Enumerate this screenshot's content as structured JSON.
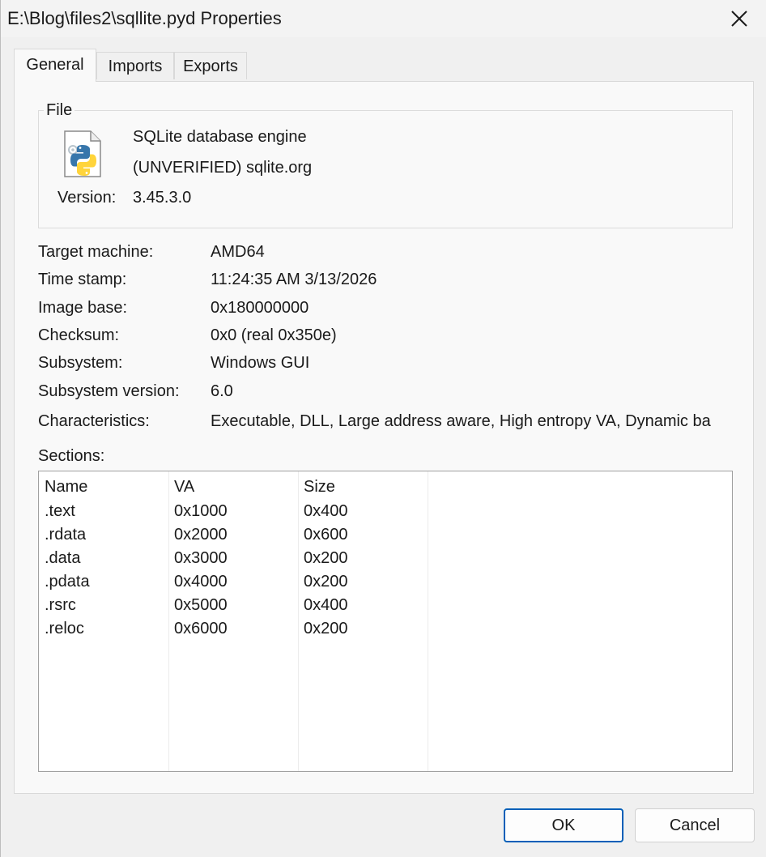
{
  "window": {
    "title": "E:\\Blog\\files2\\sqllite.pyd Properties"
  },
  "tabs": [
    {
      "label": "General",
      "active": true
    },
    {
      "label": "Imports",
      "active": false
    },
    {
      "label": "Exports",
      "active": false
    }
  ],
  "file_group": {
    "label": "File",
    "icon": "python-file-icon",
    "description": "SQLite database engine",
    "company": "(UNVERIFIED) sqlite.org",
    "version_label": "Version:",
    "version_value": "3.45.3.0"
  },
  "properties": [
    {
      "label": "Target machine:",
      "value": "AMD64"
    },
    {
      "label": "Time stamp:",
      "value": "11:24:35 AM 3/13/2026"
    },
    {
      "label": "Image base:",
      "value": "0x180000000"
    },
    {
      "label": "Checksum:",
      "value": "0x0 (real 0x350e)"
    },
    {
      "label": "Subsystem:",
      "value": "Windows GUI"
    },
    {
      "label": "Subsystem version:",
      "value": "6.0"
    },
    {
      "label": "Characteristics:",
      "value": "Executable, DLL, Large address aware, High entropy VA, Dynamic ba"
    }
  ],
  "sections": {
    "label": "Sections:",
    "columns": [
      "Name",
      "VA",
      "Size"
    ],
    "rows": [
      [
        ".text",
        "0x1000",
        "0x400"
      ],
      [
        ".rdata",
        "0x2000",
        "0x600"
      ],
      [
        ".data",
        "0x3000",
        "0x200"
      ],
      [
        ".pdata",
        "0x4000",
        "0x200"
      ],
      [
        ".rsrc",
        "0x5000",
        "0x400"
      ],
      [
        ".reloc",
        "0x6000",
        "0x200"
      ]
    ]
  },
  "buttons": {
    "ok": "OK",
    "cancel": "Cancel"
  },
  "colors": {
    "accent": "#005fb8",
    "python_blue": "#3776ab",
    "python_yellow": "#ffd43b"
  }
}
